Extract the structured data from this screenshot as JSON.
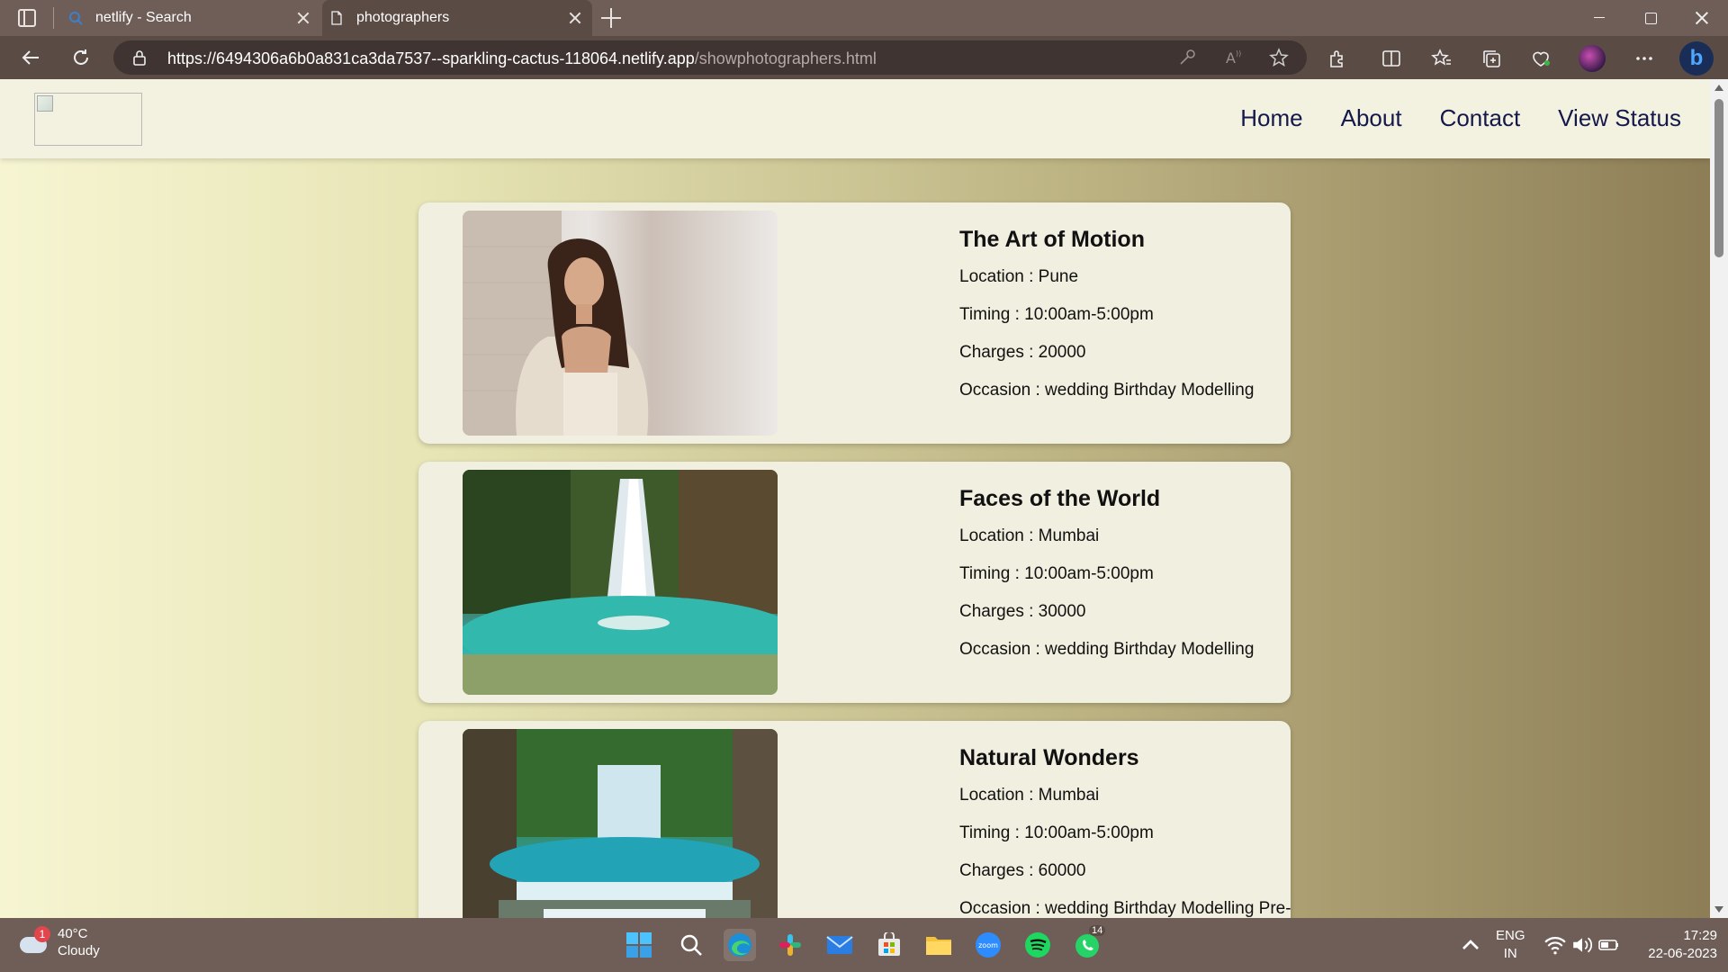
{
  "browser": {
    "tabs": [
      {
        "label": "netlify - Search",
        "active": false,
        "icon": "search-favicon"
      },
      {
        "label": "photographers",
        "active": true,
        "icon": "page-icon"
      }
    ],
    "url_main": "https://6494306a6b0a831ca3da7537--sparkling-cactus-118064.netlify.app",
    "url_path": "/showphotographers.html"
  },
  "site": {
    "nav": [
      {
        "label": "Home"
      },
      {
        "label": "About"
      },
      {
        "label": "Contact"
      },
      {
        "label": "View Status"
      }
    ],
    "cards": [
      {
        "title": "The Art of Motion",
        "location": "Location : Pune",
        "timing": "Timing : 10:00am-5:00pm",
        "charges": "Charges : 20000",
        "occasion": "Occasion : wedding Birthday Modelling",
        "image": "portrait-photo"
      },
      {
        "title": "Faces of the World",
        "location": "Location : Mumbai",
        "timing": "Timing : 10:00am-5:00pm",
        "charges": "Charges : 30000",
        "occasion": "Occasion : wedding Birthday Modelling",
        "image": "waterfall-photo"
      },
      {
        "title": "Natural Wonders",
        "location": "Location : Mumbai",
        "timing": "Timing : 10:00am-5:00pm",
        "charges": "Charges : 60000",
        "occasion": "Occasion : wedding Birthday Modelling Pre-",
        "image": "waterfall-photo"
      }
    ]
  },
  "taskbar": {
    "weather": {
      "temp": "40°C",
      "condition": "Cloudy",
      "badge": "1"
    },
    "whatsapp_badge": "14",
    "lang_line1": "ENG",
    "lang_line2": "IN",
    "time": "17:29",
    "date": "22-06-2023"
  }
}
